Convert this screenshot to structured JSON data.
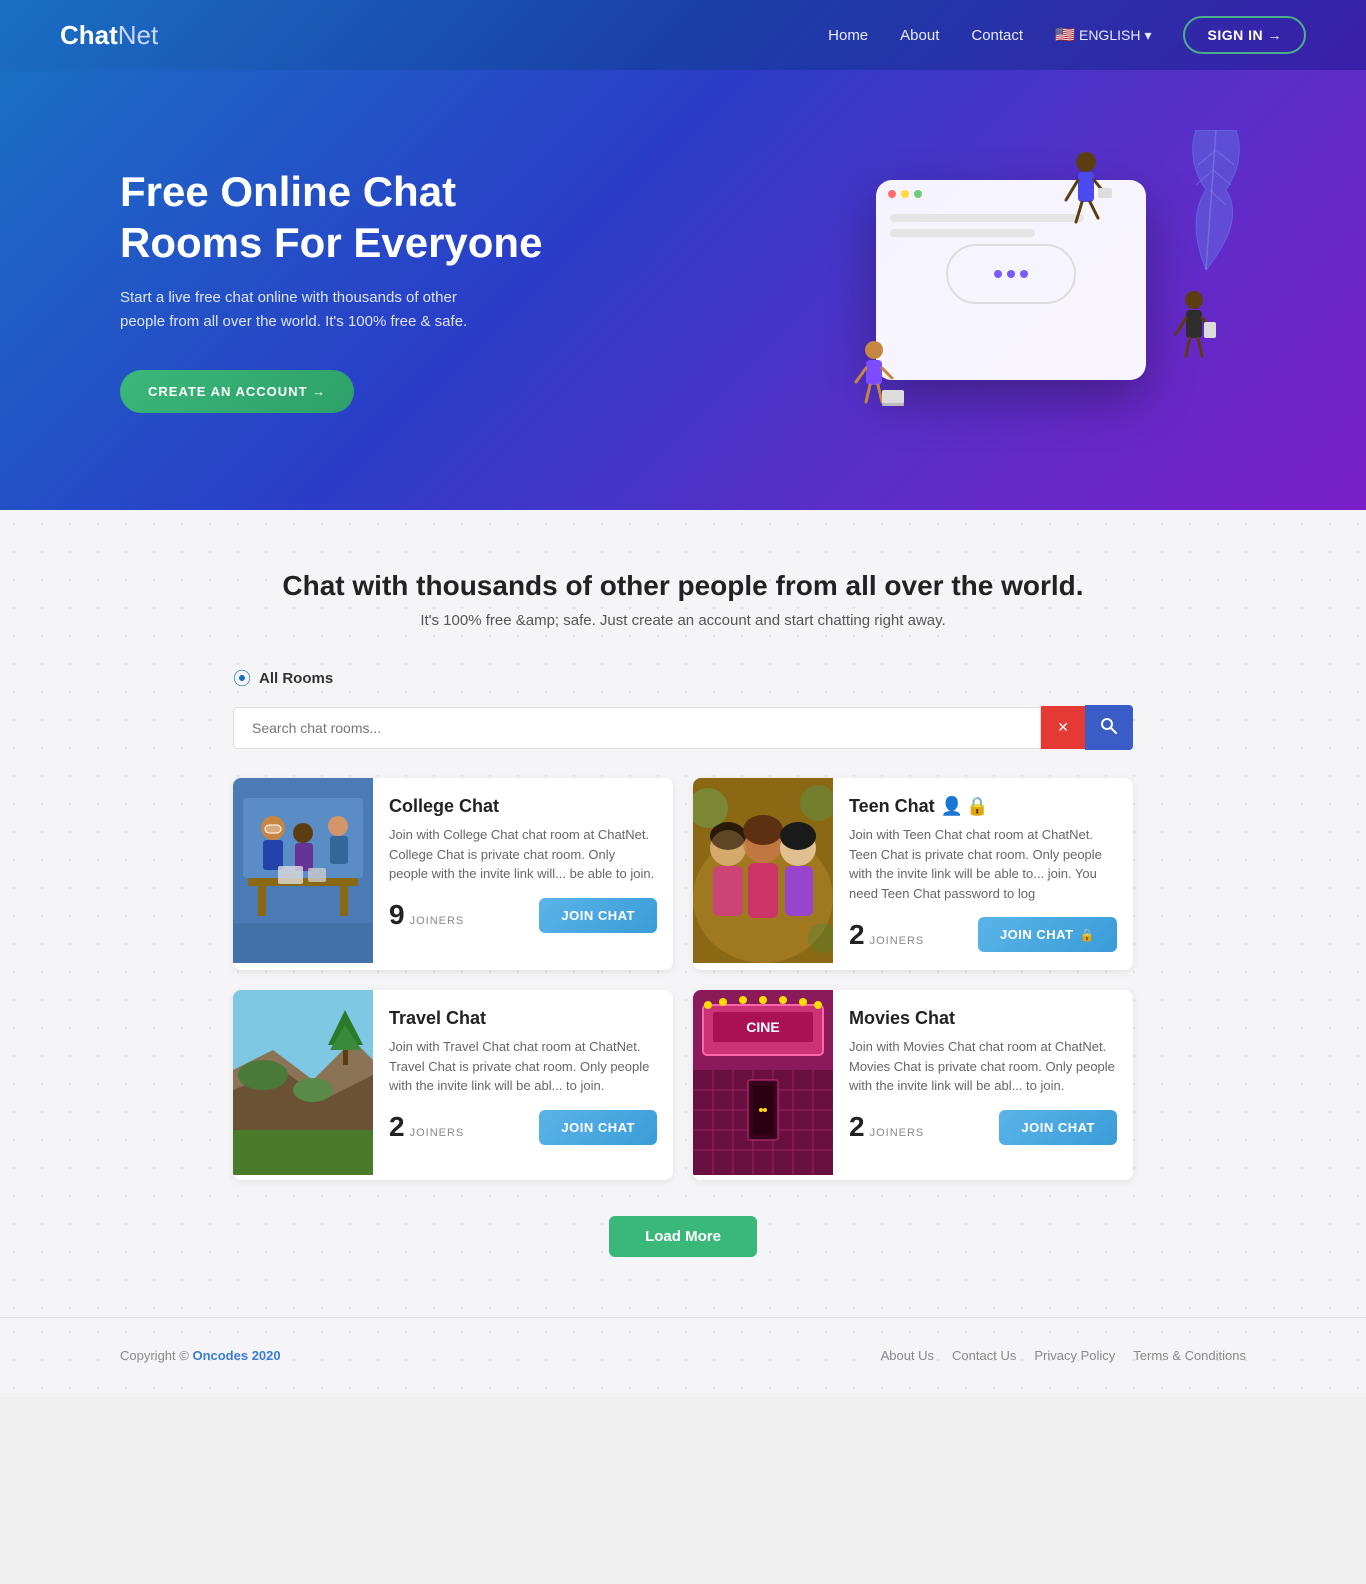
{
  "brand": {
    "chat": "Chat",
    "net": "Net"
  },
  "navbar": {
    "links": [
      {
        "label": "Home",
        "href": "#"
      },
      {
        "label": "About",
        "href": "#"
      },
      {
        "label": "Contact",
        "href": "#"
      }
    ],
    "lang": "ENGLISH",
    "signin": "SIGN IN →"
  },
  "hero": {
    "title": "Free Online Chat Rooms For Everyone",
    "subtitle": "Start a live free chat online with thousands of other people from all over the world. It's 100% free & safe.",
    "cta": "CREATE AN ACCOUNT →"
  },
  "main": {
    "heading": "Chat with thousands of other people from all over the world.",
    "subheading": "It's 100% free &amp; safe. Just create an account and start chatting right away.",
    "rooms_label": "All Rooms",
    "search_placeholder": "Search chat rooms...",
    "clear_btn": "✕",
    "search_btn": "🔍"
  },
  "rooms": [
    {
      "title": "College Chat",
      "description": "Join with College Chat chat room at ChatNet. College Chat is private chat room. Only people with the invite link will... be able to join.",
      "joiners": "9",
      "joiners_label": "JOINERS",
      "join_btn": "JOIN CHAT",
      "private": false,
      "img_type": "college"
    },
    {
      "title": "Teen Chat",
      "description": "Join with Teen Chat chat room at ChatNet. Teen Chat is private chat room. Only people with the invite link will be able to... join. You need Teen Chat password to log",
      "joiners": "2",
      "joiners_label": "JOINERS",
      "join_btn": "JOIN CHAT",
      "private": true,
      "img_type": "teen"
    },
    {
      "title": "Travel Chat",
      "description": "Join with Travel Chat chat room at ChatNet. Travel Chat is private chat room. Only people with the invite link will be abl... to join.",
      "joiners": "2",
      "joiners_label": "JOINERS",
      "join_btn": "JOIN CHAT",
      "private": false,
      "img_type": "travel"
    },
    {
      "title": "Movies Chat",
      "description": "Join with Movies Chat chat room at ChatNet. Movies Chat is private chat room. Only people with the invite link will be abl... to join.",
      "joiners": "2",
      "joiners_label": "JOINERS",
      "join_btn": "JOIN CHAT",
      "private": false,
      "img_type": "movies"
    }
  ],
  "load_more": "Load More",
  "footer": {
    "copyright": "Copyright © Oncodes 2020",
    "links": [
      "About Us",
      "Contact Us",
      "Privacy Policy",
      "Terms & Conditions"
    ]
  }
}
